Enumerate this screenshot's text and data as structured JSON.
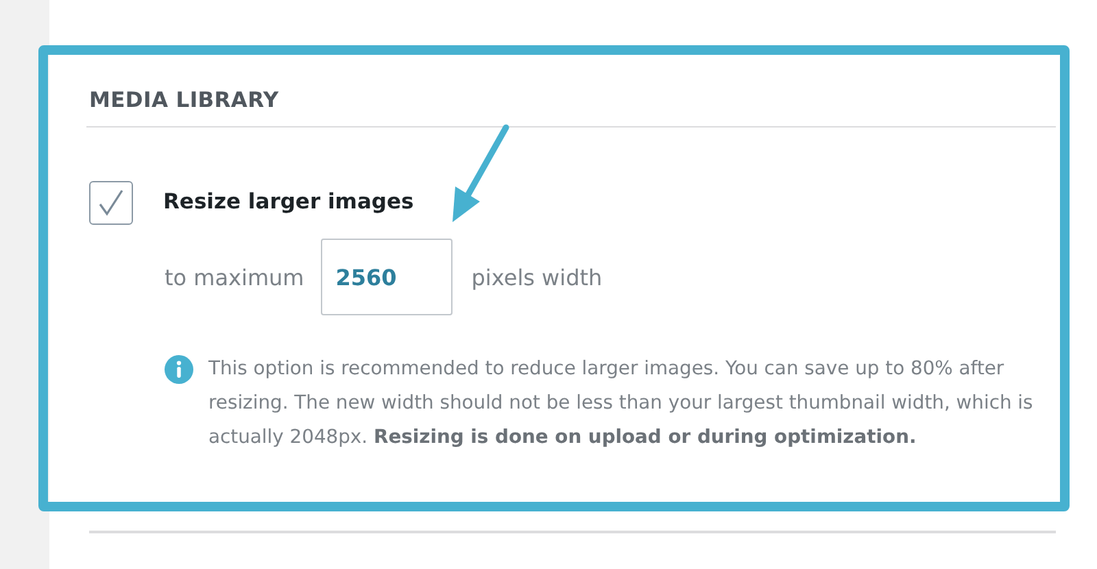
{
  "section": {
    "title": "MEDIA LIBRARY"
  },
  "resize_option": {
    "label": "Resize larger images",
    "checked": true
  },
  "max_width": {
    "prefix": "to maximum",
    "value": "2560",
    "suffix": "pixels width"
  },
  "note": {
    "text": "This option is recommended to reduce larger images. You can save up to 80% after resizing. The new width should not be less than your largest thumbnail width, which is actually 2048px. **Resizing is done on upload or during optimization.**"
  }
}
